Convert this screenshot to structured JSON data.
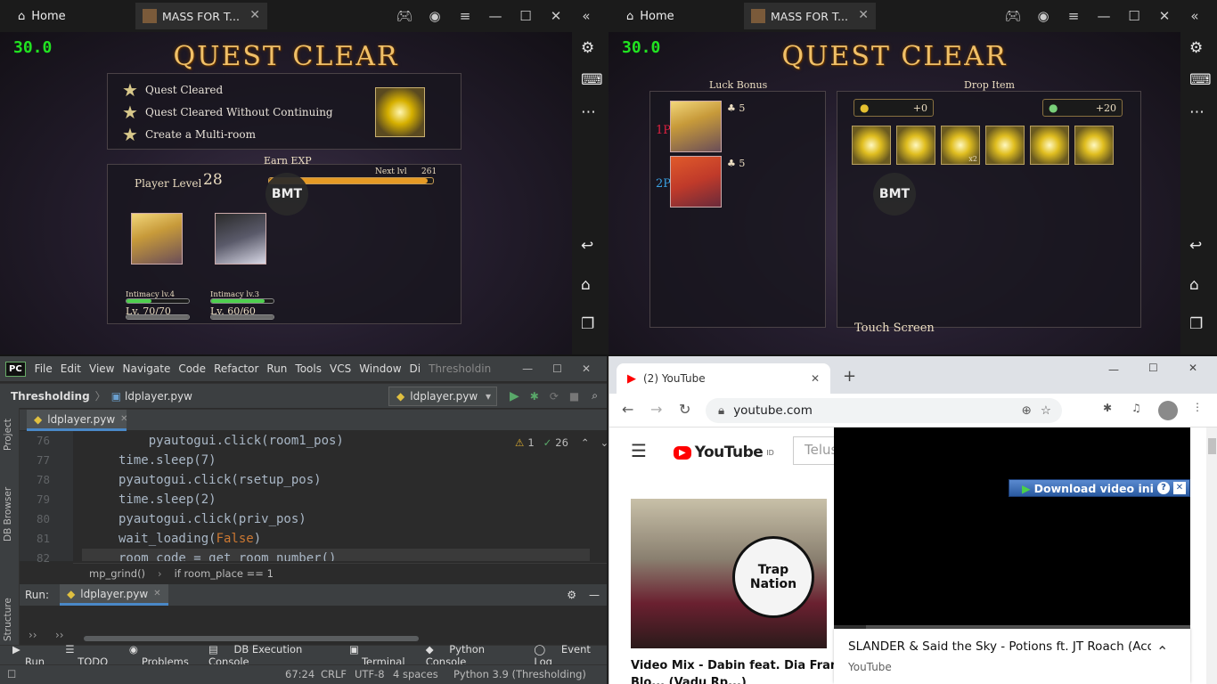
{
  "emulator": {
    "home_label": "Home",
    "tab_label": "MASS FOR T...",
    "fps": "30.0",
    "quest_title": "QUEST CLEAR"
  },
  "left_game": {
    "quests": [
      "Quest Cleared",
      "Quest Cleared Without Continuing",
      "Create a Multi-room"
    ],
    "earn_exp": "Earn EXP",
    "player_level_label": "Player Level",
    "player_level": "28",
    "next_lvl_label": "Next lvl",
    "next_lvl_value": "261",
    "exp_progress": 0.97,
    "brand": "BMT",
    "units": [
      {
        "lv": "Lv. 70/70",
        "intimacy": "Intimacy lv.4",
        "intimacy_fill": 0.4
      },
      {
        "lv": "Lv. 60/60",
        "intimacy": "Intimacy lv.3",
        "intimacy_fill": 0.85
      }
    ]
  },
  "right_game": {
    "luck_bonus": "Luck Bonus",
    "drop_item": "Drop Item",
    "players": [
      {
        "tag": "1P",
        "luck": "5"
      },
      {
        "tag": "2P",
        "luck": "5"
      }
    ],
    "gold": "+0",
    "gem": "+20",
    "drop_multiplier": "x2",
    "touch": "Touch Screen",
    "brand": "BMT"
  },
  "pycharm": {
    "logo": "PC",
    "menu": [
      "File",
      "Edit",
      "View",
      "Navigate",
      "Code",
      "Refactor",
      "Run",
      "Tools",
      "VCS",
      "Window",
      "Di",
      "Thresholdin"
    ],
    "project": "Thresholding",
    "file": "ldplayer.pyw",
    "run_config": "ldplayer.pyw",
    "tab": "ldplayer.pyw",
    "warnings": "1",
    "checks": "26",
    "lines": [
      {
        "n": "76",
        "text": "    pyautogui.click(room1_pos)"
      },
      {
        "n": "77",
        "text": "time.sleep(7)"
      },
      {
        "n": "78",
        "text": "pyautogui.click(rsetup_pos)"
      },
      {
        "n": "79",
        "text": "time.sleep(2)"
      },
      {
        "n": "80",
        "text": "pyautogui.click(priv_pos)"
      },
      {
        "n": "81",
        "text": "wait_loading(",
        "kw": "False",
        "end": ")"
      },
      {
        "n": "82",
        "text": "room_code = get_room_number()"
      }
    ],
    "crumbs": [
      "mp_grind()",
      "if room_place == 1"
    ],
    "run_label": "Run:",
    "run_tab": "ldplayer.pyw",
    "side": [
      "Project",
      "DB Browser",
      "Structure"
    ],
    "tools": [
      "Run",
      "TODO",
      "Problems",
      "DB Execution Console",
      "Terminal",
      "Python Console",
      "Event Log"
    ],
    "status": {
      "pos": "67:24",
      "eol": "CRLF",
      "enc": "UTF-8",
      "indent": "4 spaces",
      "interp": "Python 3.9 (Thresholding)"
    }
  },
  "chrome": {
    "tab_title": "(2) YouTube",
    "url": "youtube.com",
    "yt_logo": "YouTube",
    "yt_region": "ID",
    "search_placeholder": "Telus",
    "thumb_brand": "Trap Nation",
    "video_title": "Video Mix - Dabin feat. Dia Frampton",
    "video_title2": "Blo... (Vadu Rp...)",
    "download_label": "Download video ini",
    "mini_title": "SLANDER & Said the Sky - Potions ft. JT Roach (Aco...",
    "mini_channel": "YouTube"
  },
  "colors": {
    "fps": "#21e221",
    "gold_title": "#f0c068",
    "yt_red": "#ff0000",
    "pc_bg": "#2b2b2b"
  }
}
